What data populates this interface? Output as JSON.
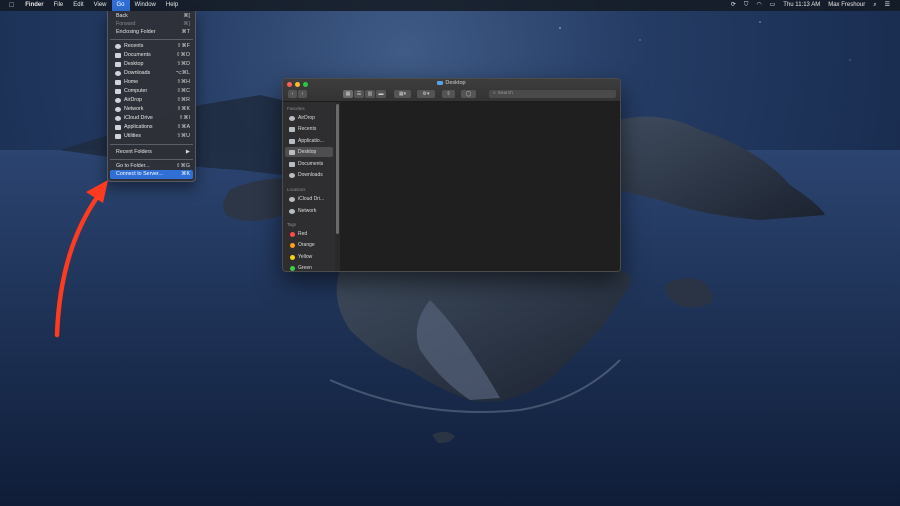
{
  "menubar": {
    "apple": "",
    "app_name": "Finder",
    "menus": [
      "File",
      "Edit",
      "View",
      "Go",
      "Window",
      "Help"
    ],
    "clock": "Thu 11:13 AM",
    "user": "Max Freshour"
  },
  "go_menu": {
    "back": {
      "label": "Back",
      "shortcut": "⌘["
    },
    "forward": {
      "label": "Forward",
      "shortcut": "⌘]"
    },
    "enclosing": {
      "label": "Enclosing Folder",
      "shortcut": "⌘T"
    },
    "places": [
      {
        "label": "Recents",
        "shortcut": "⇧⌘F",
        "icon": "clock-icon"
      },
      {
        "label": "Documents",
        "shortcut": "⇧⌘O",
        "icon": "document-icon"
      },
      {
        "label": "Desktop",
        "shortcut": "⇧⌘D",
        "icon": "desktop-icon"
      },
      {
        "label": "Downloads",
        "shortcut": "⌥⌘L",
        "icon": "download-icon"
      },
      {
        "label": "Home",
        "shortcut": "⇧⌘H",
        "icon": "home-icon"
      },
      {
        "label": "Computer",
        "shortcut": "⇧⌘C",
        "icon": "computer-icon"
      },
      {
        "label": "AirDrop",
        "shortcut": "⇧⌘R",
        "icon": "airdrop-icon"
      },
      {
        "label": "Network",
        "shortcut": "⇧⌘K",
        "icon": "globe-icon"
      },
      {
        "label": "iCloud Drive",
        "shortcut": "⇧⌘I",
        "icon": "cloud-icon"
      },
      {
        "label": "Applications",
        "shortcut": "⇧⌘A",
        "icon": "applications-icon"
      },
      {
        "label": "Utilities",
        "shortcut": "⇧⌘U",
        "icon": "utilities-icon"
      }
    ],
    "recent_folders": {
      "label": "Recent Folders",
      "arrow": "▶"
    },
    "goto_folder": {
      "label": "Go to Folder...",
      "shortcut": "⇧⌘G"
    },
    "connect_server": {
      "label": "Connect to Server...",
      "shortcut": "⌘K"
    }
  },
  "finder": {
    "title": "Desktop",
    "back": "‹",
    "forward": "›",
    "search_placeholder": "Search",
    "sidebar": {
      "favorites_header": "Favorites",
      "favorites": [
        "AirDrop",
        "Recents",
        "Applicatio...",
        "Desktop",
        "Documents",
        "Downloads"
      ],
      "locations_header": "Locations",
      "locations": [
        "iCloud Dri...",
        "Network"
      ],
      "tags_header": "Tags",
      "tags": [
        {
          "label": "Red",
          "color": "#ff4b4b"
        },
        {
          "label": "Orange",
          "color": "#ff9f1a"
        },
        {
          "label": "Yellow",
          "color": "#f5d21a"
        },
        {
          "label": "Green",
          "color": "#3fcf4a"
        }
      ]
    }
  },
  "colors": {
    "accent": "#2f6fd6",
    "annotation_arrow": "#ff3b1f"
  }
}
